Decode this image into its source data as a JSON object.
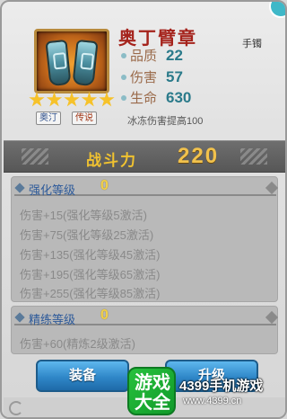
{
  "item": {
    "name": "奥丁臂章",
    "type": "手镯",
    "stars": 5,
    "tags": [
      "奥汀",
      "传说"
    ],
    "stats": [
      {
        "label": "品质",
        "value": "22"
      },
      {
        "label": "伤害",
        "value": "57"
      },
      {
        "label": "生命",
        "value": "630"
      }
    ],
    "bonus": "冰冻伤害提高100"
  },
  "power": {
    "label": "战斗力",
    "value": "220"
  },
  "enhance": {
    "title": "强化等级",
    "level": "0",
    "lines": [
      "伤害+15(强化等级5激活)",
      "伤害+75(强化等级25激活)",
      "伤害+135(强化等级45激活)",
      "伤害+195(强化等级65激活)",
      "伤害+255(强化等级85激活)"
    ]
  },
  "refine": {
    "title": "精练等级",
    "level": "0",
    "lines": [
      "伤害+60(精炼2级激活)"
    ]
  },
  "buttons": {
    "equip": "装备",
    "upgrade": "升级"
  },
  "watermark": {
    "logo_top": "游戏",
    "logo_bottom": "大全",
    "site": "4399手机游戏",
    "url": "www.4399.cn"
  },
  "colors": {
    "title": "#a5231c",
    "stat_value": "#2a7a8a",
    "power": "#f2c24c",
    "button": "#2f87c8",
    "section": "#2d5a9a"
  }
}
